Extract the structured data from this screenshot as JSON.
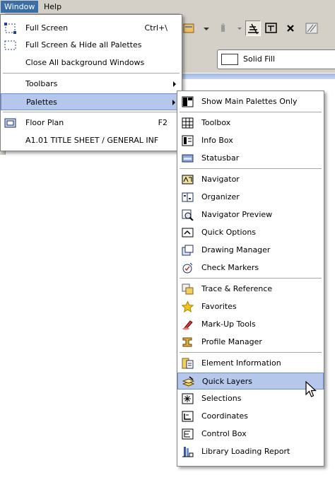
{
  "menubar": {
    "window": "Window",
    "help": "Help"
  },
  "toolbar": {
    "fill_label": "Solid Fill"
  },
  "window_menu": {
    "items": [
      {
        "label": "Full Screen",
        "shortcut": "Ctrl+\\",
        "icon": "fullscreen-icon"
      },
      {
        "label": "Full Screen & Hide all Palettes",
        "icon": "fullscreen-hide-icon"
      },
      {
        "label": "Close All background Windows"
      },
      {
        "label": "Toolbars"
      },
      {
        "label": "Palettes"
      },
      {
        "label": "Floor Plan",
        "shortcut": "F2",
        "icon": "floor-plan-icon"
      },
      {
        "label": "A1.01 TITLE SHEET / GENERAL INF"
      }
    ]
  },
  "palettes_menu": {
    "items": [
      {
        "label": "Show Main Palettes Only",
        "icon": "main-palettes-icon"
      },
      {
        "label": "Toolbox",
        "icon": "toolbox-icon"
      },
      {
        "label": "Info Box",
        "icon": "info-box-icon"
      },
      {
        "label": "Statusbar",
        "icon": "statusbar-icon"
      },
      {
        "label": "Navigator",
        "icon": "navigator-icon"
      },
      {
        "label": "Organizer",
        "icon": "organizer-icon"
      },
      {
        "label": "Navigator Preview",
        "icon": "navigator-preview-icon"
      },
      {
        "label": "Quick Options",
        "icon": "quick-options-icon"
      },
      {
        "label": "Drawing Manager",
        "icon": "drawing-manager-icon"
      },
      {
        "label": "Check Markers",
        "icon": "check-markers-icon"
      },
      {
        "label": "Trace & Reference",
        "icon": "trace-reference-icon"
      },
      {
        "label": "Favorites",
        "icon": "favorites-star-icon"
      },
      {
        "label": "Mark-Up Tools",
        "icon": "markup-tools-icon"
      },
      {
        "label": "Profile Manager",
        "icon": "profile-manager-icon"
      },
      {
        "label": "Element Information",
        "icon": "element-information-icon"
      },
      {
        "label": "Quick Layers",
        "icon": "quick-layers-icon"
      },
      {
        "label": "Selections",
        "icon": "selections-icon"
      },
      {
        "label": "Coordinates",
        "icon": "coordinates-icon"
      },
      {
        "label": "Control Box",
        "icon": "control-box-icon"
      },
      {
        "label": "Library Loading Report",
        "icon": "library-loading-report-icon"
      }
    ]
  },
  "colors": {
    "highlight": "#b5c8ec",
    "highlight_border": "#6e8fcf",
    "menubar_active": "#3b6ea5",
    "chrome": "#d4d0c8"
  }
}
